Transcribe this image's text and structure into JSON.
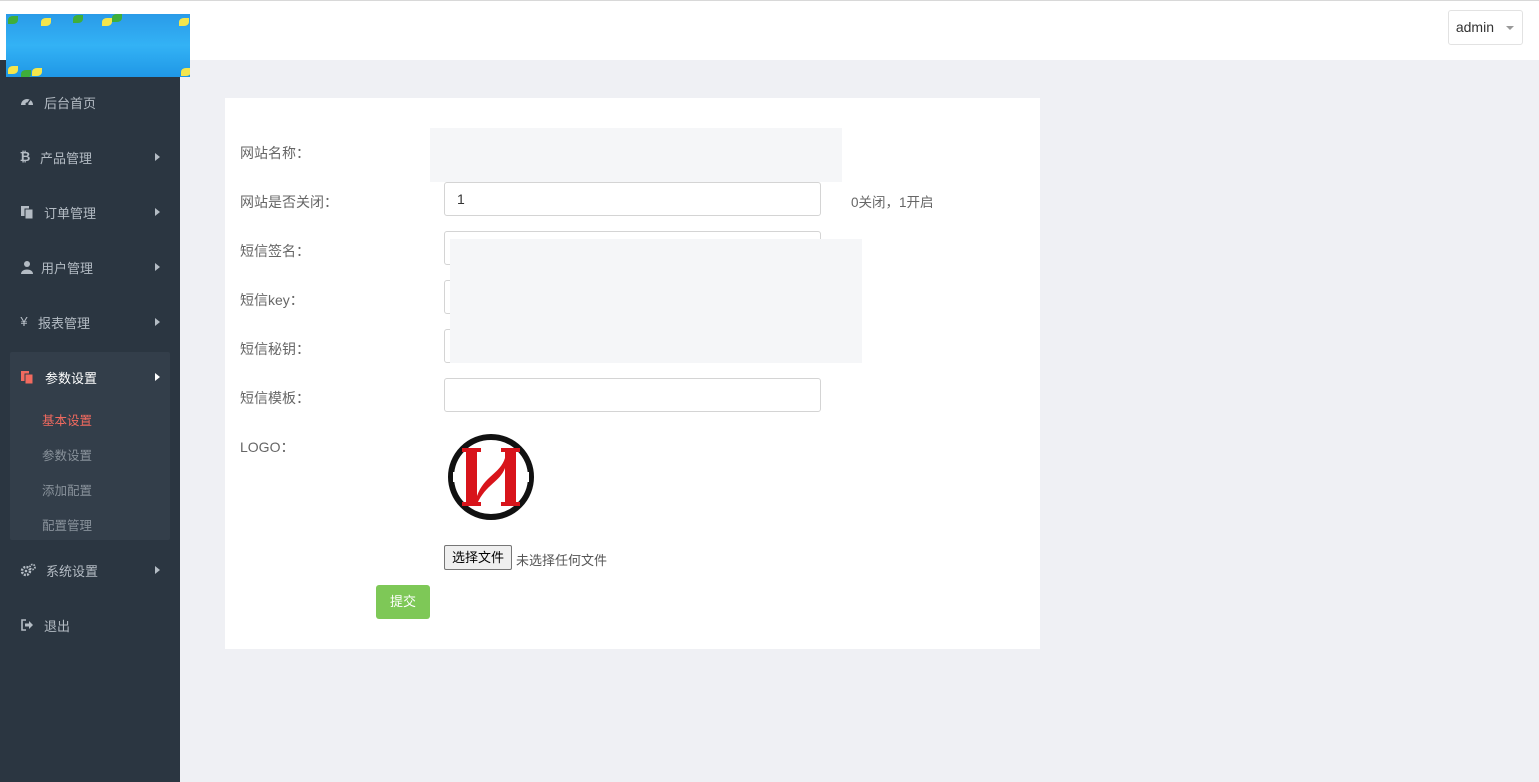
{
  "header": {
    "user_menu": "admin",
    "icons": [
      "caret-down-icon"
    ]
  },
  "sidebar": {
    "items": [
      {
        "label": "后台首页",
        "icon": "dashboard-icon"
      },
      {
        "label": "产品管理",
        "icon": "bitcoin-icon"
      },
      {
        "label": "订单管理",
        "icon": "copy-icon"
      },
      {
        "label": "用户管理",
        "icon": "user-icon"
      },
      {
        "label": "报表管理",
        "icon": "yen-icon"
      },
      {
        "label": "参数设置",
        "icon": "copy-icon",
        "active": true
      },
      {
        "label": "系统设置",
        "icon": "gears-icon"
      },
      {
        "label": "退出",
        "icon": "sign-out-icon"
      }
    ],
    "subitems": [
      {
        "label": "基本设置",
        "current": true
      },
      {
        "label": "参数设置"
      },
      {
        "label": "添加配置"
      },
      {
        "label": "配置管理"
      }
    ],
    "active_color": "#f26a5f"
  },
  "form": {
    "site_name_label": "网站名称：",
    "site_closed_label": "网站是否关闭：",
    "site_closed_value": "1",
    "site_closed_help": "0关闭，1开启",
    "sms_sign_label": "短信签名：",
    "sms_key_label": "短信key：",
    "sms_secret_label": "短信秘钥：",
    "sms_template_label": "短信模板：",
    "sms_template_value": "",
    "logo_label": "LOGO：",
    "file_button": "选择文件",
    "file_note": "未选择任何文件",
    "submit": "提交"
  },
  "colors": {
    "sidebar_bg": "#2b3641",
    "page_bg": "#eff0f4",
    "submit_bg": "#7ec857"
  }
}
